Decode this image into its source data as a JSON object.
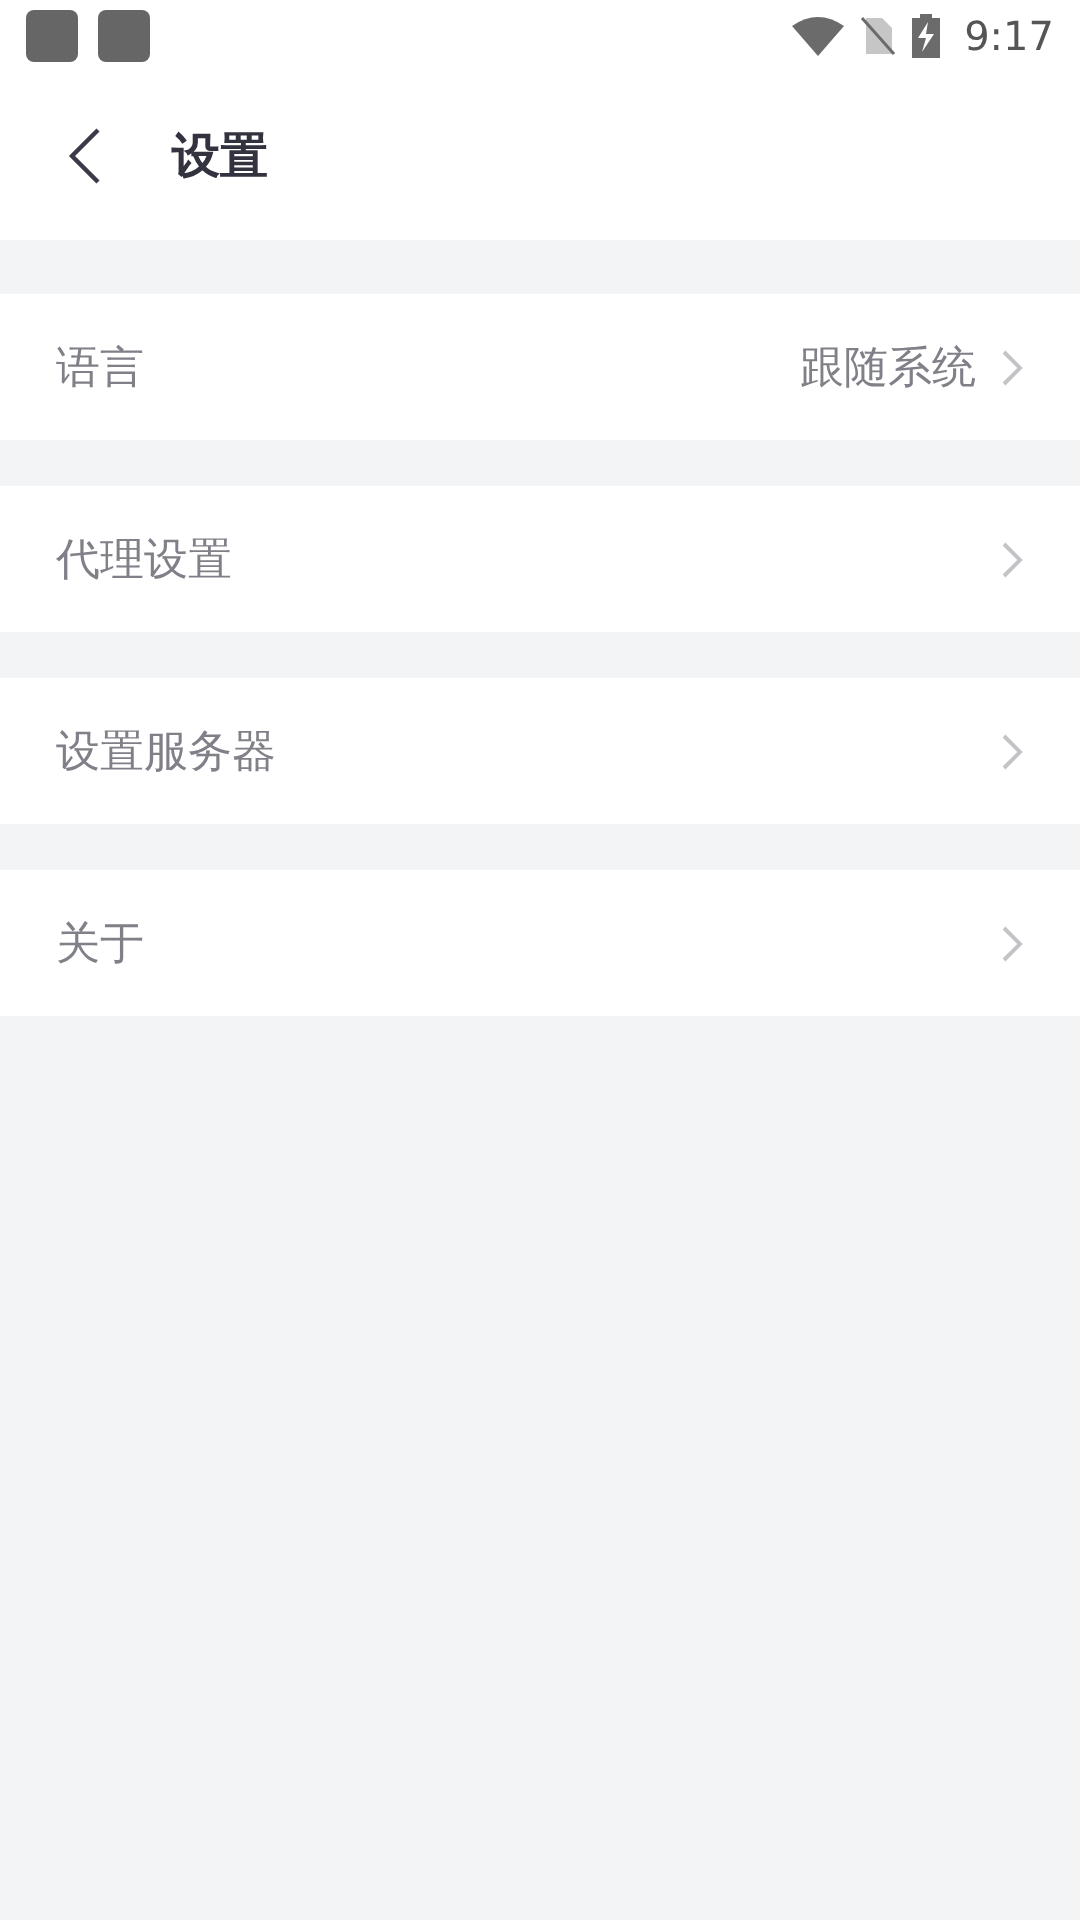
{
  "status_bar": {
    "time": "9:17"
  },
  "header": {
    "title": "设置"
  },
  "settings": [
    {
      "label": "语言",
      "value": "跟随系统"
    },
    {
      "label": "代理设置"
    },
    {
      "label": "设置服务器"
    },
    {
      "label": "关于"
    }
  ]
}
